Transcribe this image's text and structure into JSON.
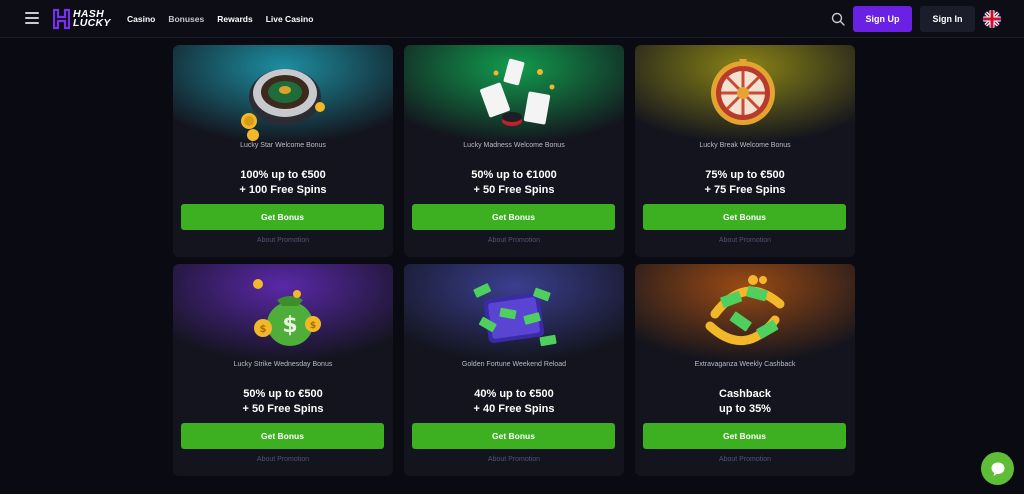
{
  "header": {
    "logo": {
      "line1": "HASH",
      "line2": "LUCKY"
    },
    "nav": [
      "Casino",
      "Bonuses",
      "Rewards",
      "Live Casino"
    ],
    "signup_label": "Sign Up",
    "signin_label": "Sign In",
    "colors": {
      "signup": "#6b21e3",
      "signin": "#1b1d2a"
    }
  },
  "cards": [
    {
      "name": "Lucky Star Welcome Bonus",
      "line1": "100% up to €500",
      "line2": "+ 100 Free Spins",
      "button": "Get Bonus",
      "link": "About Promotion",
      "icon": "roulette-icon"
    },
    {
      "name": "Lucky Madness Welcome Bonus",
      "line1": "50% up to €1000",
      "line2": "+ 50 Free Spins",
      "button": "Get Bonus",
      "link": "About Promotion",
      "icon": "cards-icon"
    },
    {
      "name": "Lucky Break Welcome Bonus",
      "line1": "75% up to €500",
      "line2": "+ 75 Free Spins",
      "button": "Get Bonus",
      "link": "About Promotion",
      "icon": "wheel-icon"
    },
    {
      "name": "Lucky Strike Wednesday Bonus",
      "line1": "50% up to €500",
      "line2": "+ 50 Free Spins",
      "button": "Get Bonus",
      "link": "About Promotion",
      "icon": "money-bag-icon"
    },
    {
      "name": "Golden Fortune Weekend Reload",
      "line1": "40% up to €500",
      "line2": "+ 40 Free Spins",
      "button": "Get Bonus",
      "link": "About Promotion",
      "icon": "cash-case-icon"
    },
    {
      "name": "Extravaganza Weekly Cashback",
      "line1": "Cashback",
      "line2": "up to 35%",
      "button": "Get Bonus",
      "link": "About Promotion",
      "icon": "cashback-icon"
    }
  ],
  "accent_colors": {
    "get_bonus": "#3cb021",
    "chat": "#5fbd38"
  }
}
